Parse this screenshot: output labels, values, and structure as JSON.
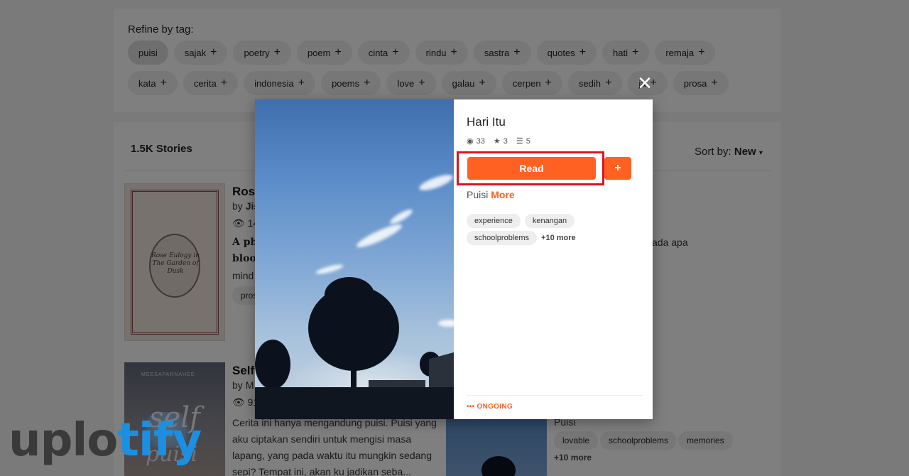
{
  "refine": {
    "label": "Refine by tag:",
    "row1": [
      "puisi",
      "sajak",
      "poetry",
      "poem",
      "cinta",
      "rindu",
      "sastra",
      "quotes",
      "hati",
      "remaja"
    ],
    "row2": [
      "kata",
      "cerita",
      "indonesia",
      "poems",
      "love",
      "galau",
      "cerpen",
      "sedih",
      "ja",
      "prosa"
    ],
    "plus_icon": "+"
  },
  "list": {
    "count": "1.5K Stories",
    "sort_label": "Sort by:",
    "sort_value": "New",
    "story1": {
      "title": "Rose",
      "by": "by",
      "author": "Jis",
      "views": "14",
      "excerpt_line1": "A ph",
      "excerpt_line2": "bloo",
      "excerpt_line3": "mind",
      "tag": "pros",
      "side_text": "ada apa",
      "cover_title": "Rose Eulogy in The Garden of Dusk"
    },
    "story2": {
      "title": "Self",
      "by": "by",
      "author": "M",
      "views": "91",
      "description": "Cerita ini hanya mengandung puisi. Puisi yang aku ciptakan sendiri untuk mengisi masa lapang, yang pada waktu itu mungkin sedang sepi? Tempat ini, akan ku jadikan seba...",
      "side_category": "Puisi",
      "tags": [
        "lovable",
        "schoolproblems",
        "memories"
      ],
      "more": "+10 more",
      "cover_script1": "self",
      "cover_script2": "puisi",
      "cover_author": "MEESAPARNAHEE"
    }
  },
  "modal": {
    "close_icon": "×",
    "title": "Hari Itu",
    "stats": {
      "reads": "33",
      "votes": "3",
      "parts": "5"
    },
    "read_label": "Read",
    "add_label": "+",
    "category": "Puisi",
    "more_label": "More",
    "tags": [
      "experience",
      "kenangan",
      "schoolproblems"
    ],
    "tags_more": "+10 more",
    "status": "••• ONGOING"
  },
  "watermark": {
    "part1": "uplo",
    "part2": "tify"
  },
  "colors": {
    "accent": "#ff6122",
    "highlight": "#d8151f",
    "watermark_blue": "#1d8fe0"
  }
}
